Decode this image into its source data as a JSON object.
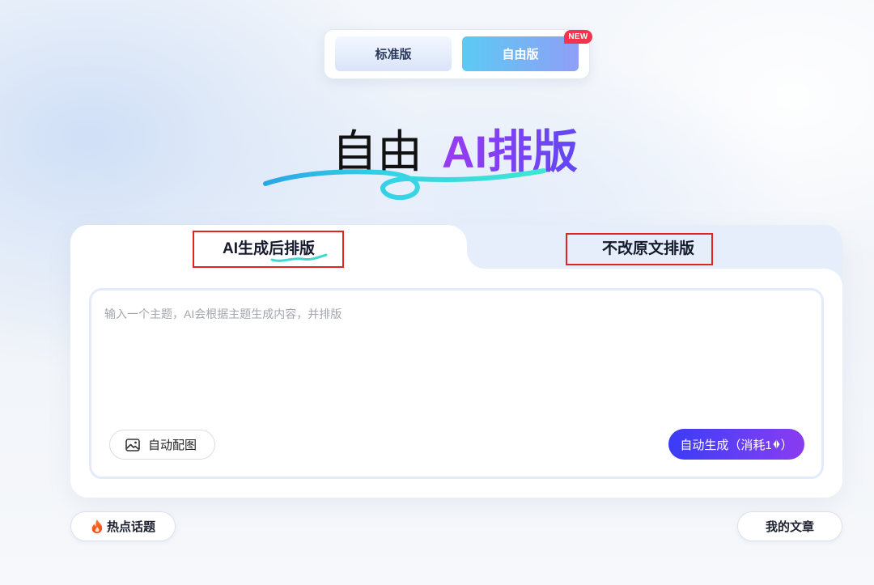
{
  "version_toggle": {
    "standard": {
      "label": "标准版",
      "selected": false
    },
    "free": {
      "label": "自由版",
      "selected": true,
      "badge": "NEW"
    }
  },
  "hero": {
    "title_plain": "自由",
    "title_accent": "AI排版"
  },
  "tabs": [
    {
      "label": "AI生成后排版",
      "active": true
    },
    {
      "label": "不改原文排版",
      "active": false
    }
  ],
  "editor": {
    "value": "",
    "placeholder": "输入一个主题，AI会根据主题生成内容，并排版",
    "auto_image": {
      "label": "自动配图",
      "icon": "image-icon"
    },
    "generate": {
      "label_before_icon": "自动生成（消耗1",
      "icon": "diamond-icon",
      "label_after_icon": "）"
    }
  },
  "footer": {
    "hot_topics": {
      "label": "热点话题",
      "icon": "fire-icon"
    },
    "my_articles": {
      "label": "我的文章"
    }
  },
  "colors": {
    "accent_start": "#3a3cf6",
    "accent_end": "#8a3cf0",
    "title_accent_start": "#9a3bf2",
    "title_accent_end": "#6148f3",
    "free_version_start": "#5ccaf3",
    "free_version_end": "#8f9ff6",
    "badge": "#f4334f",
    "swoosh": "#3fe0d6",
    "tab_inactive_bg": "#e6eefc",
    "annotation_box": "#e2241f"
  }
}
